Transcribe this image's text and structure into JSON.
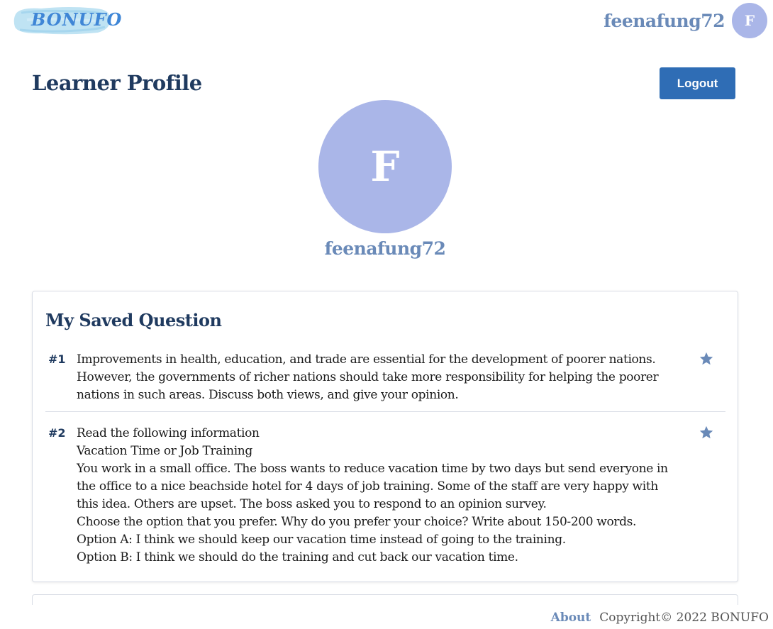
{
  "header": {
    "logo_text": "BONUFO",
    "username": "feenafung72",
    "avatar_initial": "F"
  },
  "page": {
    "title": "Learner Profile",
    "logout_label": "Logout"
  },
  "profile": {
    "avatar_initial": "F",
    "username": "feenafung72"
  },
  "saved_questions": {
    "title": "My Saved Question",
    "items": [
      {
        "number": "#1",
        "lines": [
          "Improvements in health, education, and trade are essential for the development of poorer nations.",
          "However, the governments of richer nations should take more responsibility for helping the poorer",
          "nations in such areas. Discuss both views, and give your opinion."
        ],
        "saved_icon": "star-icon"
      },
      {
        "number": "#2",
        "lines": [
          "Read the following information",
          "Vacation Time or Job Training",
          "You work in a small office. The boss wants to reduce vacation time by two days but send everyone in",
          "the office to a nice beachside hotel for 4 days of job training. Some of the staff are very happy with",
          "this idea. Others are upset. The boss asked you to respond to an opinion survey.",
          "Choose the option that you prefer. Why do you prefer your choice? Write about 150-200 words.",
          "Option A: I think we should keep our vacation time instead of going to the training.",
          "Option B: I think we should do the training and cut back our vacation time."
        ],
        "saved_icon": "star-icon"
      }
    ]
  },
  "footer": {
    "about_label": "About",
    "copyright": "Copyright© 2022 BONUFO"
  },
  "colors": {
    "primary_button": "#2f6db5",
    "avatar_bg": "#aab6e8",
    "username_text": "#6a8ab8",
    "heading_text": "#1f3a5f",
    "star": "#6a8ab8"
  }
}
